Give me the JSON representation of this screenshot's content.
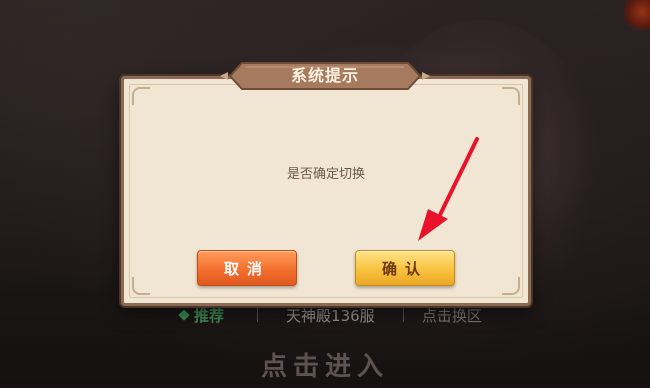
{
  "dialog": {
    "title": "系统提示",
    "message": "是否确定切换",
    "cancel_label": "取消",
    "confirm_label": "确认"
  },
  "server_bar": {
    "tag": "推荐",
    "server_name": "天神殿136服",
    "switch_label": "点击换区"
  },
  "enter_label": "点击进入",
  "colors": {
    "dialog_bg": "#f1e6d3",
    "dialog_border": "#8a6a52",
    "title_plate": "#a57a5e",
    "cancel_button": "#f36f2e",
    "confirm_button": "#f8c23f",
    "annotation_arrow": "#e8132a",
    "recommend_tag": "#3f8c55"
  },
  "icons": [
    "recommend-diamond-icon",
    "annotation-arrow-icon"
  ]
}
